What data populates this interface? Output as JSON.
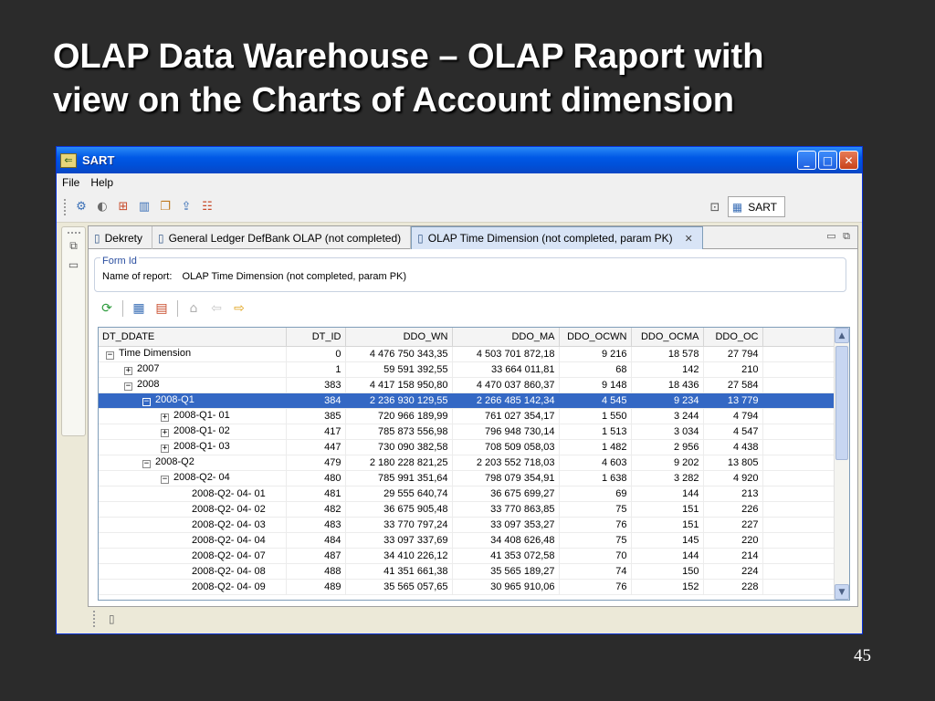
{
  "slide": {
    "title_line1": "OLAP Data Warehouse – OLAP Raport with",
    "title_line2": "view on the Charts of Account dimension",
    "page_number": "45"
  },
  "window": {
    "title": "SART",
    "min_icon": "minimize-icon",
    "max_icon": "maximize-icon",
    "close_icon": "close-icon"
  },
  "menu": {
    "file": "File",
    "help": "Help"
  },
  "perspective": {
    "label": "SART"
  },
  "tabs": [
    {
      "label": "Dekrety"
    },
    {
      "label": "General Ledger DefBank OLAP (not completed)"
    },
    {
      "label": "OLAP Time Dimension (not completed, param PK)"
    }
  ],
  "form": {
    "legend": "Form Id",
    "name_label": "Name of report:",
    "name_value": "OLAP Time Dimension (not completed, param PK)"
  },
  "grid": {
    "columns": [
      "DT_DDATE",
      "DT_ID",
      "DDO_WN",
      "DDO_MA",
      "DDO_OCWN",
      "DDO_OCMA",
      "DDO_OC"
    ],
    "rows": [
      {
        "name": "Time Dimension",
        "toggle": "−",
        "level": 0,
        "selected": false,
        "cells": [
          "0",
          "4 476 750 343,35",
          "4 503 701 872,18",
          "9 216",
          "18 578",
          "27 794"
        ]
      },
      {
        "name": "2007",
        "toggle": "+",
        "level": 1,
        "selected": false,
        "cells": [
          "1",
          "59 591 392,55",
          "33 664 011,81",
          "68",
          "142",
          "210"
        ]
      },
      {
        "name": "2008",
        "toggle": "−",
        "level": 1,
        "selected": false,
        "cells": [
          "383",
          "4 417 158 950,80",
          "4 470 037 860,37",
          "9 148",
          "18 436",
          "27 584"
        ]
      },
      {
        "name": "2008-Q1",
        "toggle": "−",
        "level": 2,
        "selected": true,
        "cells": [
          "384",
          "2 236 930 129,55",
          "2 266 485 142,34",
          "4 545",
          "9 234",
          "13 779"
        ]
      },
      {
        "name": "2008-Q1- 01",
        "toggle": "+",
        "level": 3,
        "selected": false,
        "cells": [
          "385",
          "720 966 189,99",
          "761 027 354,17",
          "1 550",
          "3 244",
          "4 794"
        ]
      },
      {
        "name": "2008-Q1- 02",
        "toggle": "+",
        "level": 3,
        "selected": false,
        "cells": [
          "417",
          "785 873 556,98",
          "796 948 730,14",
          "1 513",
          "3 034",
          "4 547"
        ]
      },
      {
        "name": "2008-Q1- 03",
        "toggle": "+",
        "level": 3,
        "selected": false,
        "cells": [
          "447",
          "730 090 382,58",
          "708 509 058,03",
          "1 482",
          "2 956",
          "4 438"
        ]
      },
      {
        "name": "2008-Q2",
        "toggle": "−",
        "level": 2,
        "selected": false,
        "cells": [
          "479",
          "2 180 228 821,25",
          "2 203 552 718,03",
          "4 603",
          "9 202",
          "13 805"
        ]
      },
      {
        "name": "2008-Q2- 04",
        "toggle": "−",
        "level": 3,
        "selected": false,
        "cells": [
          "480",
          "785 991 351,64",
          "798 079 354,91",
          "1 638",
          "3 282",
          "4 920"
        ]
      },
      {
        "name": "2008-Q2- 04- 01",
        "toggle": "",
        "level": 4,
        "selected": false,
        "cells": [
          "481",
          "29 555 640,74",
          "36 675 699,27",
          "69",
          "144",
          "213"
        ]
      },
      {
        "name": "2008-Q2- 04- 02",
        "toggle": "",
        "level": 4,
        "selected": false,
        "cells": [
          "482",
          "36 675 905,48",
          "33 770 863,85",
          "75",
          "151",
          "226"
        ]
      },
      {
        "name": "2008-Q2- 04- 03",
        "toggle": "",
        "level": 4,
        "selected": false,
        "cells": [
          "483",
          "33 770 797,24",
          "33 097 353,27",
          "76",
          "151",
          "227"
        ]
      },
      {
        "name": "2008-Q2- 04- 04",
        "toggle": "",
        "level": 4,
        "selected": false,
        "cells": [
          "484",
          "33 097 337,69",
          "34 408 626,48",
          "75",
          "145",
          "220"
        ]
      },
      {
        "name": "2008-Q2- 04- 07",
        "toggle": "",
        "level": 4,
        "selected": false,
        "cells": [
          "487",
          "34 410 226,12",
          "41 353 072,58",
          "70",
          "144",
          "214"
        ]
      },
      {
        "name": "2008-Q2- 04- 08",
        "toggle": "",
        "level": 4,
        "selected": false,
        "cells": [
          "488",
          "41 351 661,38",
          "35 565 189,27",
          "74",
          "150",
          "224"
        ]
      },
      {
        "name": "2008-Q2- 04- 09",
        "toggle": "",
        "level": 4,
        "selected": false,
        "cells": [
          "489",
          "35 565 057,65",
          "30 965 910,06",
          "76",
          "152",
          "228"
        ]
      }
    ]
  }
}
